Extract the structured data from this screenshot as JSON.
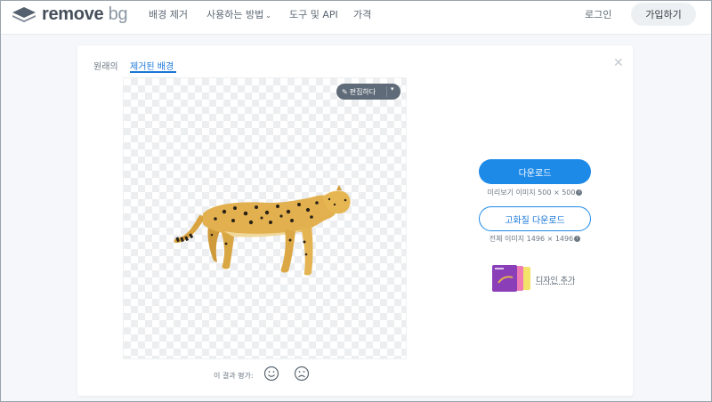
{
  "header": {
    "logo": {
      "main": "remove",
      "suffix": "bg"
    },
    "nav": [
      {
        "label": "배경 제거",
        "has_dropdown": false
      },
      {
        "label": "사용하는 방법",
        "has_dropdown": true
      },
      {
        "label": "도구 및 API",
        "has_dropdown": false
      },
      {
        "label": "가격",
        "has_dropdown": false
      }
    ],
    "login": "로그인",
    "signup": "가입하기"
  },
  "editor": {
    "tabs": [
      {
        "label": "원래의",
        "active": false
      },
      {
        "label": "제거된 배경",
        "active": true
      }
    ],
    "close_icon": "close-icon",
    "edit_button": "편집하다",
    "rating_label": "이 결과 평가:",
    "download": {
      "label": "다운로드",
      "info": "미리보기 이미지 500 × 500"
    },
    "download_hd": {
      "label": "고화질 다운로드",
      "info": "전체 이미지 1496 × 1496"
    },
    "add_design": "디자인 추가"
  },
  "colors": {
    "accent": "#1d8ae8",
    "text": "#454f5b",
    "background": "#f5f7fa"
  }
}
